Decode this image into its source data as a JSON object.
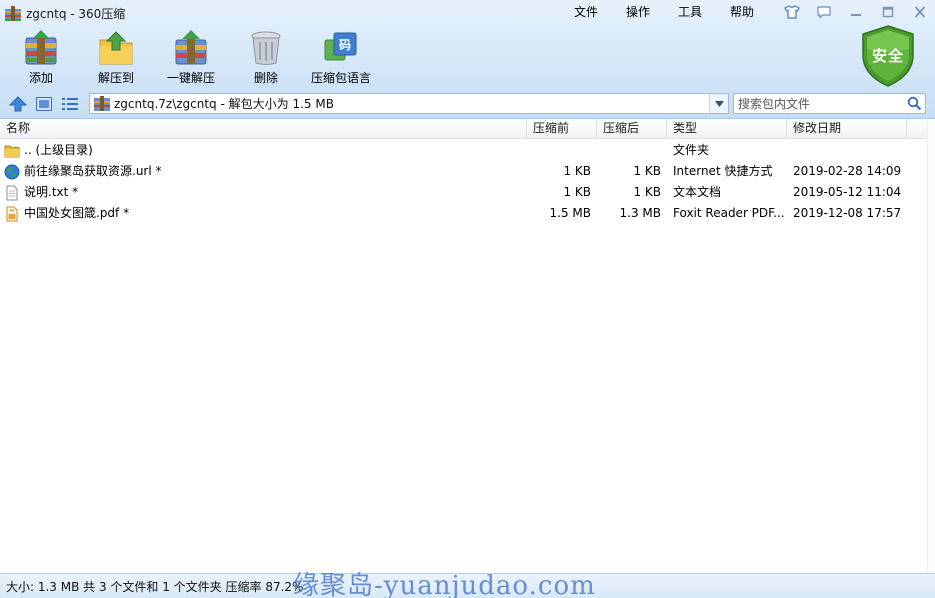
{
  "window": {
    "title": "zgcntq - 360压缩"
  },
  "menu": {
    "items": [
      "文件",
      "操作",
      "工具",
      "帮助"
    ]
  },
  "toolbar": {
    "buttons": [
      {
        "label": "添加",
        "icon": "add-archive-icon"
      },
      {
        "label": "解压到",
        "icon": "extract-to-icon"
      },
      {
        "label": "一键解压",
        "icon": "one-click-extract-icon"
      },
      {
        "label": "删除",
        "icon": "delete-trash-icon"
      },
      {
        "label": "压缩包语言",
        "icon": "archive-language-icon"
      }
    ],
    "safe_badge": "安全"
  },
  "address": {
    "path": "zgcntq.7z\\zgcntq - 解包大小为 1.5 MB",
    "search_placeholder": "搜索包内文件"
  },
  "list": {
    "columns": {
      "name": "名称",
      "size": "压缩前",
      "packed": "压缩后",
      "type": "类型",
      "date": "修改日期"
    },
    "rows": [
      {
        "name": ".. (上级目录)",
        "size": "",
        "packed": "",
        "type": "文件夹",
        "date": "",
        "icon": "folder-icon"
      },
      {
        "name": "前往缘聚岛获取资源.url *",
        "size": "1 KB",
        "packed": "1 KB",
        "type": "Internet 快捷方式",
        "date": "2019-02-28 14:09",
        "icon": "internet-shortcut-icon"
      },
      {
        "name": "说明.txt *",
        "size": "1 KB",
        "packed": "1 KB",
        "type": "文本文档",
        "date": "2019-05-12 11:04",
        "icon": "text-file-icon"
      },
      {
        "name": "中国处女图箴.pdf *",
        "size": "1.5 MB",
        "packed": "1.3 MB",
        "type": "Foxit Reader PDF...",
        "date": "2019-12-08 17:57",
        "icon": "pdf-file-icon"
      }
    ]
  },
  "status": {
    "text": "大小: 1.3 MB 共 3 个文件和 1 个文件夹 压缩率 87.2%"
  },
  "watermark": {
    "text": "缘聚岛-yuanjudao.com"
  },
  "colors": {
    "chrome_top": "#e6f1fb",
    "chrome_bottom": "#c6def4",
    "safe_badge_green": "#4a9a2e",
    "watermark_blue": "#3c6ec8"
  }
}
